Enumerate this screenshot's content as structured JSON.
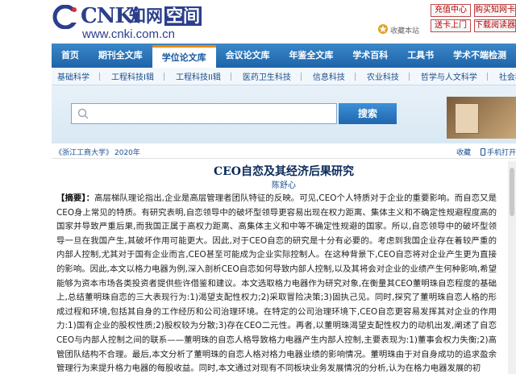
{
  "header": {
    "logo_text": "CNKi",
    "logo_cn_a": "知网",
    "logo_cn_b": "空间",
    "logo_url": "www.cnki.com.cn",
    "favorite_label": "收藏本站",
    "buttons": [
      "充值中心",
      "购买知网卡",
      "送卡上门",
      "下载阅读器"
    ]
  },
  "mainnav": {
    "items": [
      "首页",
      "期刊全文库",
      "学位论文库",
      "会议论文库",
      "年鉴全文库",
      "学术百科",
      "工具书",
      "学术不端检测"
    ],
    "active": "学位论文库"
  },
  "subnav": {
    "items": [
      "基础科学",
      "工程科技I辑",
      "工程科技II辑",
      "医药卫生科技",
      "信息科技",
      "农业科技",
      "哲学与人文科学",
      "社会科学I辑"
    ]
  },
  "search": {
    "placeholder": "",
    "button_label": "搜索"
  },
  "source": {
    "name": "《浙江工商大学》",
    "year": "2020年",
    "collect": "收藏",
    "mobile": "手机打开"
  },
  "article": {
    "title": "CEO自恋及其经济后果研究",
    "author": "陈舒心",
    "abstract_label": "【摘要】：",
    "abstract_text": "高层梯队理论指出,企业是高层管理者团队特征的反映。可见,CEO个人特质对于企业的重要影响。而自恋又是CEO身上常见的特质。有研究表明,自恋领导中的破坏型领导更容易出现在权力距离、集体主义和不确定性规避程度高的国家并导致严重后果,而我国正属于高权力距离、高集体主义和中等不确定性规避的国家。所以,自恋领导中的破坏型领导一旦在我国产生,其破坏作用可能更大。因此,对于CEO自恋的研究是十分有必要的。考虑到我国企业存在着较严重的内部人控制,尤其对于国有企业而言,CEO甚至可能成为企业实际控制人。在这种背景下,CEO自恋将对企业产生更为直接的影响。因此,本文以格力电器为例,深入剖析CEO自恋如何导致内部人控制,以及其将会对企业的业绩产生何种影响,希望能够为资本市场各类投资者提供些许借鉴和建议。本文选取格力电器作为研究对象,在衡量其CEO董明珠自恋程度的基础上,总结董明珠自恋的三大表现行为:1)渴望支配性权力;2)采取冒险决策;3)固执己见。同时,探究了董明珠自恋人格的形成过程和环境,包括其自身的工作经历和公司治理环境。在特定的公司治理环境下,CEO自恋更容易发挥其对企业的作用力:1)国有企业的股权性质;2)股权较为分散;3)存在CEO二元性。再者,以董明珠渴望支配性权力的动机出发,阐述了自恋CEO与内部人控制之间的联系——董明珠的自恋人格导致格力电器产生内部人控制,主要表现为:1)董事会权力失衡;2)高管团队结构不合理。最后,本文分析了董明珠的自恋人格对格力电器业绩的影响情况。董明珠由于对自身成功的追求盈余管理行为来提升格力电器的每股收益。同时,本文通过对现有不同板块业务发展情况的分析,认为在格力电器发展的初"
  },
  "colors": {
    "brand_blue": "#2b3f8c",
    "nav_blue": "#1e63a8",
    "active_tab_accent": "#f08a00",
    "link_blue": "#1a4f8f",
    "button_red": "#b10000"
  }
}
